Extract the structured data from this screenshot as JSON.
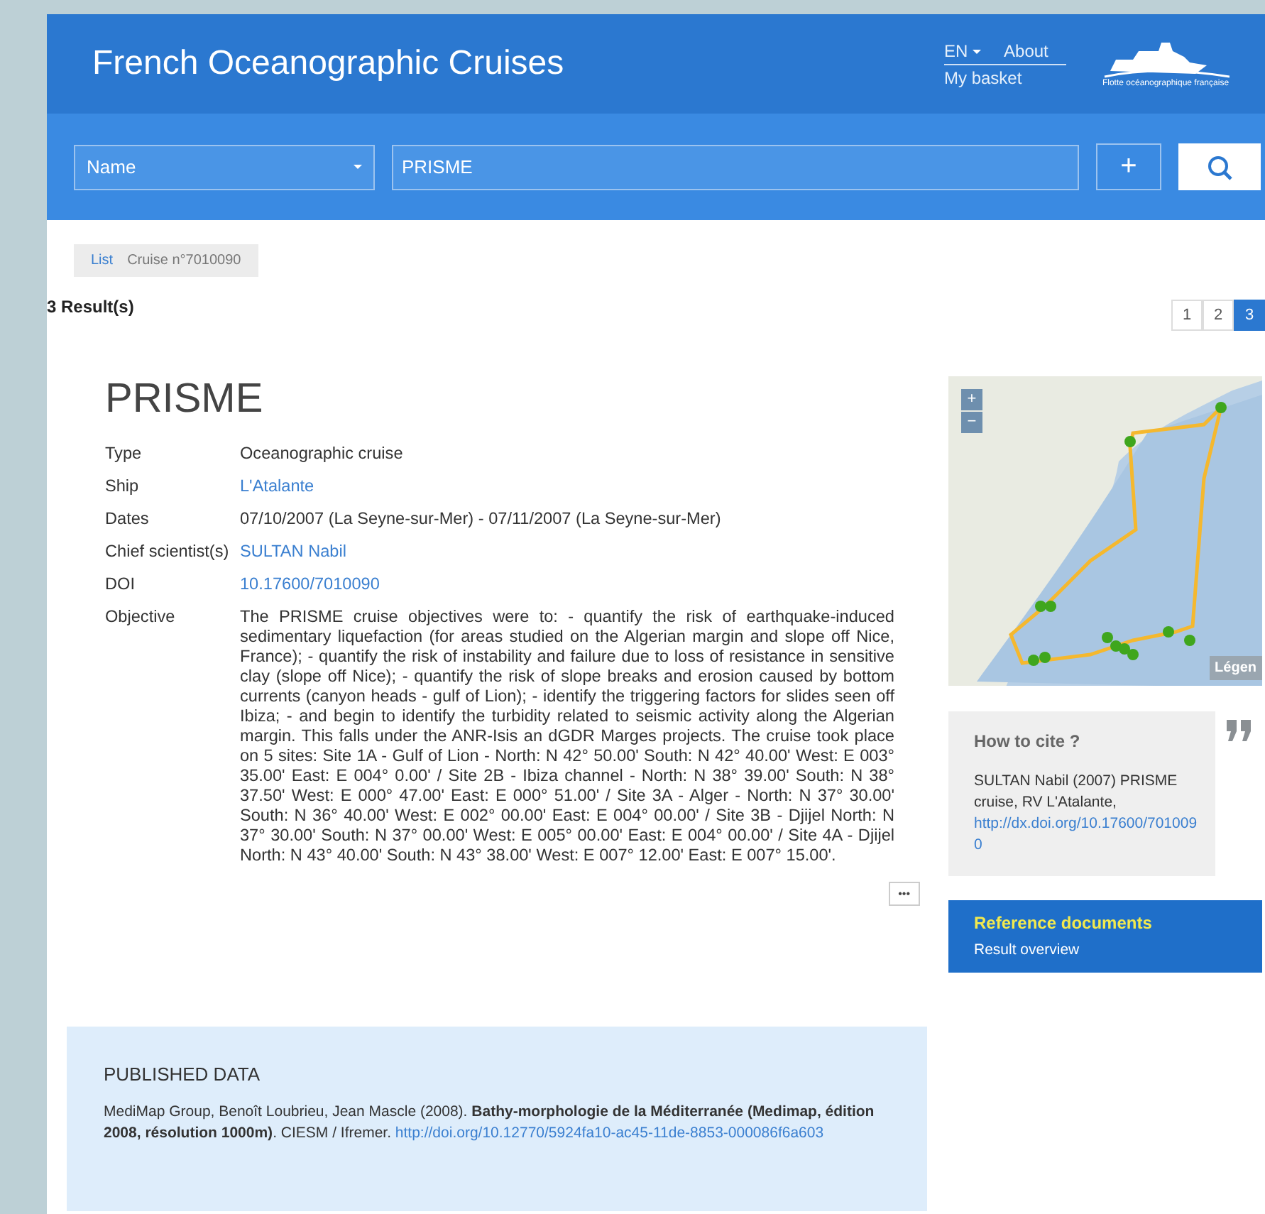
{
  "header": {
    "title": "French Oceanographic Cruises",
    "language": "EN",
    "about": "About",
    "basket": "My basket",
    "logo_caption": "Flotte océanographique française"
  },
  "search": {
    "field": "Name",
    "query": "PRISME",
    "add": "+"
  },
  "breadcrumb": [
    {
      "label": "List",
      "link": true
    },
    {
      "label": "Cruise n°7010090",
      "link": false
    }
  ],
  "results_count": "3 Result(s)",
  "pagination": [
    {
      "label": "1",
      "selected": false
    },
    {
      "label": "2",
      "selected": false
    },
    {
      "label": "3",
      "selected": true
    }
  ],
  "cruise": {
    "title": "PRISME",
    "fields": [
      {
        "label": "Type",
        "value": "Oceanographic cruise",
        "link": false
      },
      {
        "label": "Ship",
        "value": "L'Atalante",
        "link": true
      },
      {
        "label": "Dates",
        "value": "07/10/2007 (La Seyne-sur-Mer) - 07/11/2007 (La Seyne-sur-Mer)",
        "link": false
      },
      {
        "label": "Chief scientist(s)",
        "value": "SULTAN Nabil",
        "link": true
      },
      {
        "label": "DOI",
        "value": "10.17600/7010090",
        "link": true
      },
      {
        "label": "Objective",
        "value": "The PRISME cruise objectives were to: - quantify the risk of earthquake-induced sedimentary liquefaction (for areas studied on the Algerian margin and slope off Nice, France); - quantify the risk of instability and failure due to loss of resistance in sensitive clay (slope off Nice); - quantify the risk of slope breaks and erosion caused by bottom currents (canyon heads - gulf of Lion); - identify the triggering factors for slides seen off Ibiza; - and begin to identify the turbidity related to seismic activity along the Algerian margin. This falls under the ANR-Isis an dGDR Marges projects. The cruise took place on 5 sites: Site 1A - Gulf of Lion - North: N 42° 50.00' South: N 42° 40.00' West: E 003° 35.00' East: E 004° 0.00' / Site 2B - Ibiza channel - North: N 38° 39.00' South: N 38° 37.50' West: E 000° 47.00' East: E 000° 51.00' / Site 3A - Alger - North: N 37° 30.00' South: N 36° 40.00' West: E 002° 00.00' East: E 004° 00.00' / Site 3B - Djijel North: N 37° 30.00' South: N 37° 00.00' West: E 005° 00.00' East: E 004° 00.00' / Site 4A - Djijel North: N 43° 40.00' South: N 43° 38.00' West: E 007° 12.00' East: E 007° 15.00'.",
        "link": false
      }
    ],
    "more": "•••"
  },
  "map": {
    "zoom_in": "+",
    "zoom_out": "−",
    "legend": "Légen"
  },
  "cite": {
    "title": "How to cite ?",
    "text": "SULTAN Nabil (2007) PRISME cruise, RV L'Atalante,",
    "link": "http://dx.doi.org/10.17600/7010090"
  },
  "reference": {
    "title": "Reference documents",
    "link": "Result overview"
  },
  "published": {
    "title": "PUBLISHED DATA",
    "text": "MediMap Group, Benoît Loubrieu, Jean Mascle (2008). **Bathy-morphologie de la Méditerranée (Medimap, édition 2008, résolution 1000m)**. CIESM / Ifremer.",
    "link": "http://doi.org/10.12770/5924fa10-ac45-11de-8853-000086f6a603"
  }
}
